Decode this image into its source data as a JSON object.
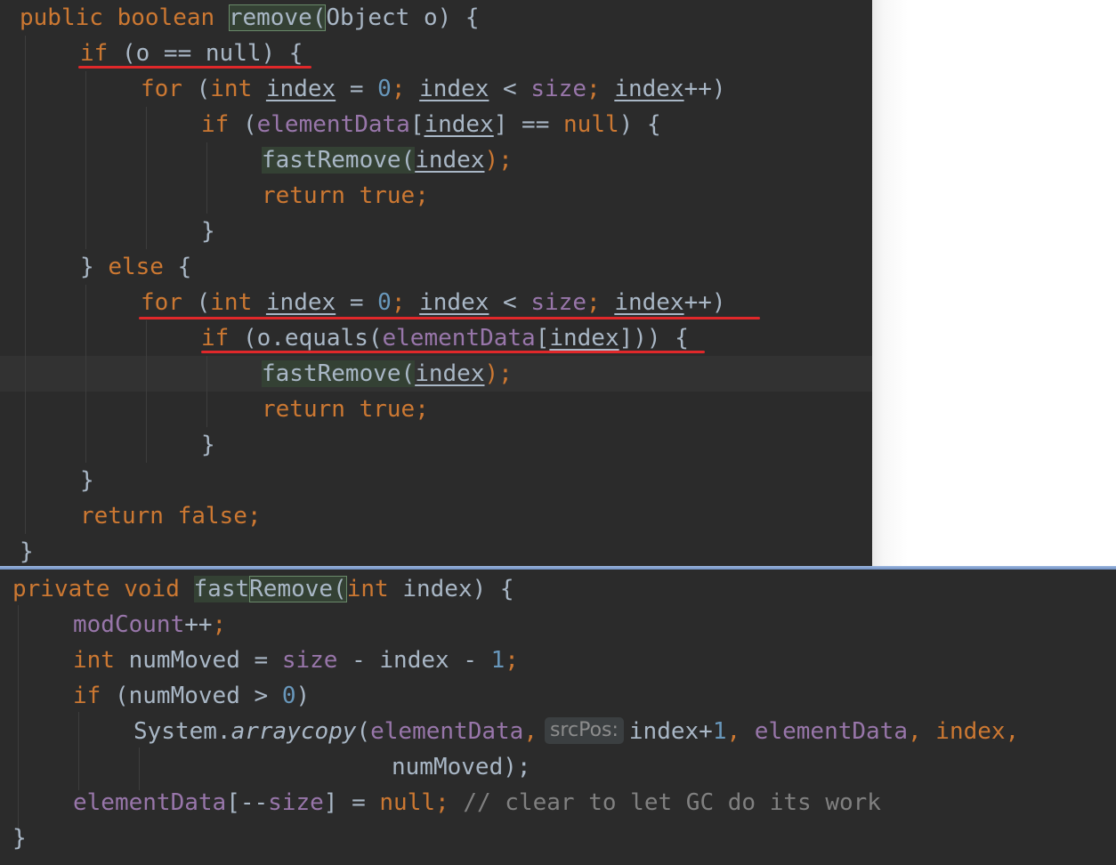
{
  "remove_method": {
    "signature": {
      "public": "public",
      "boolean": "boolean",
      "name": "remove",
      "open_paren": "(",
      "param_type_rest": "Object o) {"
    },
    "line2": {
      "if": "if",
      "cond": "(o == null)",
      "brace": " {"
    },
    "line3": {
      "for": "for",
      "open": " (",
      "int": "int",
      "v1": "index",
      "eq": " = ",
      "zero": "0",
      "semi1": "; ",
      "v2": "index",
      "lt": " < ",
      "size": "size",
      "semi2": "; ",
      "v3": "index",
      "inc": "++)"
    },
    "line4": {
      "if": "if",
      "open": " (",
      "field": "elementData",
      "lb": "[",
      "v": "index",
      "rest": "] == ",
      "null": "null",
      "end": ") {"
    },
    "line5": {
      "pre": "fast",
      "hl": "Remove(",
      "v": "index",
      "end": ");"
    },
    "line6": {
      "return": "return",
      "true": "true",
      "semi": ";"
    },
    "line7": "}",
    "line8": {
      "brace": "} ",
      "else": "else",
      "open": " {"
    },
    "line9": {
      "for": "for",
      "open": " (",
      "int": "int",
      "v1": "index",
      "eq": " = ",
      "zero": "0",
      "semi1": "; ",
      "v2": "index",
      "lt": " < ",
      "size": "size",
      "semi2": "; ",
      "v3": "index",
      "inc": "++)"
    },
    "line10": {
      "if": "if",
      "pre": " (o.equals(",
      "field": "elementData",
      "lb": "[",
      "v": "index",
      "end": "])) {"
    },
    "line11": {
      "pre": "fast",
      "hl": "Remove(",
      "v": "index",
      "end": ");"
    },
    "line12": {
      "return": "return",
      "true": "true",
      "semi": ";"
    },
    "line13": "}",
    "line14": "}",
    "line15": {
      "return": "return",
      "false": "false",
      "semi": ";"
    },
    "line16": "}"
  },
  "fastRemove_method": {
    "line1": {
      "private": "private",
      "void": "void",
      "name_pre": "fast",
      "name_hl": "Remove(",
      "int": "int",
      "rest": " index) {"
    },
    "line2": {
      "field": "modCount",
      "rest": "++",
      "semi": ";"
    },
    "line3": {
      "int": "int",
      "mid": " numMoved = ",
      "size": "size",
      "rest": " - index - ",
      "one": "1",
      "semi": ";"
    },
    "line4": {
      "if": "if",
      "pre": " (numMoved > ",
      "zero": "0",
      "end": ")"
    },
    "line5": {
      "pre": "System.",
      "method": "arraycopy",
      "open": "(",
      "field1": "elementData",
      "comma1": ",",
      "hint": "srcPos:",
      "mid": "index+",
      "one": "1",
      "comma2": ", ",
      "field2": "elementData",
      "comma3": ", index,"
    },
    "line6": {
      "text": "numMoved);"
    },
    "line7": {
      "field": "elementData",
      "lb": "[--",
      "size": "size",
      "rb": "] = ",
      "null": "null",
      "semi": ";",
      "comment": " // clear to let GC do its work"
    },
    "line8": "}"
  },
  "colors": {
    "keyword": "#cc7832",
    "number": "#6897bb",
    "field": "#9876aa",
    "text": "#a9b7c6",
    "comment": "#808080",
    "annotation_red": "#e0282a",
    "background": "#2b2b2b"
  }
}
